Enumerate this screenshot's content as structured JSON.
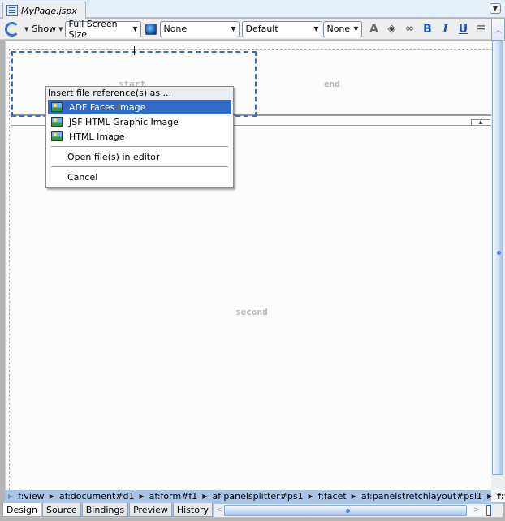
{
  "editor_tab": {
    "label": "MyPage.jspx",
    "icon": "jspx-file-icon"
  },
  "tab_menu_icon": "chevron-down-icon",
  "toolbar": {
    "refresh_icon": "refresh-icon",
    "show_label": "Show",
    "screen_size": "Full Screen Size",
    "skin_icon": "globe-icon",
    "style_class": "None",
    "font_family": "Default",
    "font_size": "None",
    "style_icon": "style-selector-icon",
    "paint_icon": "paint-bucket-icon",
    "link_icon": "link-icon",
    "bold_label": "B",
    "italic_label": "I",
    "underline_label": "U",
    "list_icon": "numbered-list-icon"
  },
  "canvas": {
    "start_label": "start",
    "end_label": "end",
    "second_label": "second"
  },
  "context_menu": {
    "header": "Insert file reference(s) as ...",
    "items": [
      {
        "label": "ADF Faces Image",
        "icon": "image-icon",
        "highlighted": true
      },
      {
        "label": "JSF HTML Graphic Image",
        "icon": "image-icon",
        "highlighted": false
      },
      {
        "label": "HTML Image",
        "icon": "image-icon",
        "highlighted": false
      }
    ],
    "open_label": "Open file(s) in editor",
    "cancel_label": "Cancel"
  },
  "breadcrumb": {
    "items": [
      "f:view",
      "af:document#d1",
      "af:form#f1",
      "af:panelsplitter#ps1",
      "f:facet",
      "af:panelstretchlayout#psl1",
      "f:facet"
    ]
  },
  "bottom_tabs": [
    "Design",
    "Source",
    "Bindings",
    "Preview",
    "History"
  ],
  "active_bottom_tab": "Design"
}
